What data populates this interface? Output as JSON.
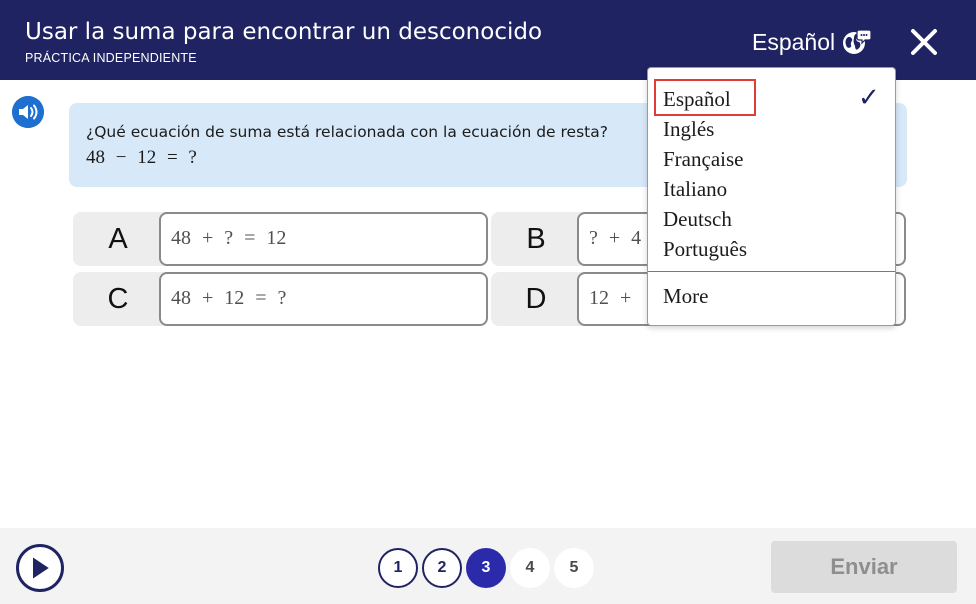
{
  "header": {
    "title": "Usar la suma para encontrar un desconocido",
    "subtitle": "PRÁCTICA INDEPENDIENTE",
    "language_label": "Español",
    "colors": {
      "background": "#1f2361",
      "text": "#ffffff"
    }
  },
  "question": {
    "text": "¿Qué ecuación de suma está relacionada con la ecuación de resta?",
    "equation": "48 − 12 = ?"
  },
  "choices": [
    {
      "letter": "A",
      "equation": "48 + ? = 12"
    },
    {
      "letter": "B",
      "equation": "? + 4"
    },
    {
      "letter": "C",
      "equation": "48 + 12 = ?"
    },
    {
      "letter": "D",
      "equation": "12 +"
    }
  ],
  "language_menu": {
    "selected": "Español",
    "items": [
      "Español",
      "Inglés",
      "Française",
      "Italiano",
      "Deutsch",
      "Português"
    ],
    "more_label": "More",
    "check_mark": "✓",
    "highlight_color": "#e03a3a"
  },
  "footer": {
    "pages": [
      {
        "label": "1",
        "state": "done"
      },
      {
        "label": "2",
        "state": "done"
      },
      {
        "label": "3",
        "state": "current"
      },
      {
        "label": "4",
        "state": "todo"
      },
      {
        "label": "5",
        "state": "todo"
      }
    ],
    "submit_label": "Enviar",
    "accent_color": "#2b2aab"
  }
}
